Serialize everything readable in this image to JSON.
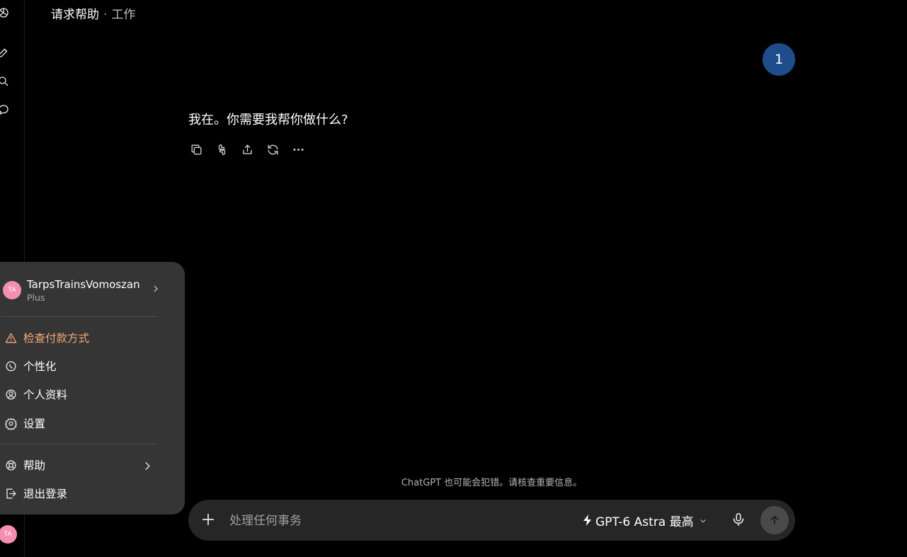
{
  "header": {
    "title": "请求帮助",
    "separator": "·",
    "project": "工作"
  },
  "user_message": {
    "badge": "1"
  },
  "assistant": {
    "text": "我在。你需要我帮你做什么?"
  },
  "account_menu": {
    "avatar_initials": "TA",
    "user_name": "TarpsTrainsVomoszan",
    "plan": "Plus",
    "items": [
      {
        "label": "检查付款方式",
        "icon": "warning-icon"
      },
      {
        "label": "个性化",
        "icon": "personalize-icon"
      },
      {
        "label": "个人资料",
        "icon": "profile-icon"
      },
      {
        "label": "设置",
        "icon": "gear-icon"
      },
      {
        "label": "帮助",
        "icon": "lifebuoy-icon"
      },
      {
        "label": "退出登录",
        "icon": "logout-icon"
      }
    ]
  },
  "footer": {
    "disclaimer": "ChatGPT 也可能会犯错。请核查重要信息。"
  },
  "composer": {
    "placeholder": "处理任何事务",
    "model": "GPT-6 Astra 最高"
  },
  "colors": {
    "accent_bubble": "#1f4c8a",
    "warning": "#f3a878",
    "avatar": "#f48fb1"
  }
}
